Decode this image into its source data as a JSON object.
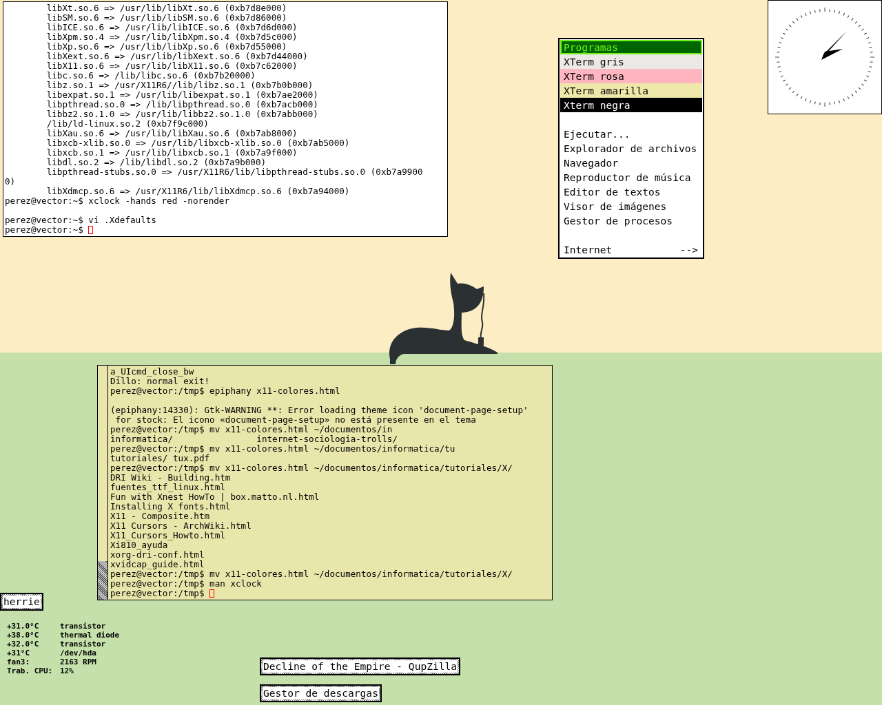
{
  "top_terminal": {
    "lines": [
      {
        "kind": "text",
        "text": "\tlibXt.so.6 => /usr/lib/libXt.so.6 (0xb7d8e000)"
      },
      {
        "kind": "text",
        "text": "\tlibSM.so.6 => /usr/lib/libSM.so.6 (0xb7d86000)"
      },
      {
        "kind": "text",
        "text": "\tlibICE.so.6 => /usr/lib/libICE.so.6 (0xb7d6d000)"
      },
      {
        "kind": "text",
        "text": "\tlibXpm.so.4 => /usr/lib/libXpm.so.4 (0xb7d5c000)"
      },
      {
        "kind": "text",
        "text": "\tlibXp.so.6 => /usr/lib/libXp.so.6 (0xb7d55000)"
      },
      {
        "kind": "text",
        "text": "\tlibXext.so.6 => /usr/lib/libXext.so.6 (0xb7d44000)"
      },
      {
        "kind": "text",
        "text": "\tlibX11.so.6 => /usr/lib/libX11.so.6 (0xb7c62000)"
      },
      {
        "kind": "text",
        "text": "\tlibc.so.6 => /lib/libc.so.6 (0xb7b20000)"
      },
      {
        "kind": "text",
        "text": "\tlibz.so.1 => /usr/X11R6//lib/libz.so.1 (0xb7b0b000)"
      },
      {
        "kind": "text",
        "text": "\tlibexpat.so.1 => /usr/lib/libexpat.so.1 (0xb7ae2000)"
      },
      {
        "kind": "text",
        "text": "\tlibpthread.so.0 => /lib/libpthread.so.0 (0xb7acb000)"
      },
      {
        "kind": "text",
        "text": "\tlibbz2.so.1.0 => /usr/lib/libbz2.so.1.0 (0xb7abb000)"
      },
      {
        "kind": "text",
        "text": "\t/lib/ld-linux.so.2 (0xb7f9c000)"
      },
      {
        "kind": "text",
        "text": "\tlibXau.so.6 => /usr/lib/libXau.so.6 (0xb7ab8000)"
      },
      {
        "kind": "text",
        "text": "\tlibxcb-xlib.so.0 => /usr/lib/libxcb-xlib.so.0 (0xb7ab5000)"
      },
      {
        "kind": "text",
        "text": "\tlibxcb.so.1 => /usr/lib/libxcb.so.1 (0xb7a9f000)"
      },
      {
        "kind": "text",
        "text": "\tlibdl.so.2 => /lib/libdl.so.2 (0xb7a9b000)"
      },
      {
        "kind": "text",
        "text": "\tlibpthread-stubs.so.0 => /usr/X11R6/lib/libpthread-stubs.so.0 (0xb7a9900"
      },
      {
        "kind": "text",
        "text": "0)"
      },
      {
        "kind": "text",
        "text": "\tlibXdmcp.so.6 => /usr/X11R6/lib/libXdmcp.so.6 (0xb7a94000)"
      },
      {
        "kind": "text",
        "text": "perez@vector:~$ xclock -hands red -norender"
      },
      {
        "kind": "blank"
      },
      {
        "kind": "text",
        "text": "perez@vector:~$ vi .Xdefaults"
      }
    ],
    "prompt": "perez@vector:~$ "
  },
  "menu": {
    "items": [
      {
        "kind": "header",
        "label": "Programas",
        "color": "#006400"
      },
      {
        "kind": "item",
        "label": "XTerm gris",
        "color": "#ebe8e6"
      },
      {
        "kind": "item",
        "label": "XTerm rosa",
        "color": "#ffb6c1"
      },
      {
        "kind": "item",
        "label": "XTerm amarilla",
        "color": "#eee8aa"
      },
      {
        "kind": "item",
        "label": "Xterm negra",
        "color": "#000000"
      },
      {
        "kind": "gap"
      },
      {
        "kind": "item",
        "label": "Ejecutar..."
      },
      {
        "kind": "item",
        "label": "Explorador de archivos"
      },
      {
        "kind": "item",
        "label": "Navegador"
      },
      {
        "kind": "item",
        "label": "Reproductor de música"
      },
      {
        "kind": "item",
        "label": "Editor de textos"
      },
      {
        "kind": "item",
        "label": "Visor de imágenes"
      },
      {
        "kind": "item",
        "label": "Gestor de procesos"
      },
      {
        "kind": "gap"
      },
      {
        "kind": "submenu",
        "label": "Internet",
        "arrow": "-->"
      }
    ]
  },
  "bottom_terminal": {
    "lines": [
      {
        "kind": "text",
        "text": "a_UIcmd_close_bw"
      },
      {
        "kind": "text",
        "text": "Dillo: normal exit!"
      },
      {
        "kind": "text",
        "text": "perez@vector:/tmp$ epiphany x11-colores.html"
      },
      {
        "kind": "blank"
      },
      {
        "kind": "text",
        "text": "(epiphany:14330): Gtk-WARNING **: Error loading theme icon 'document-page-setup'"
      },
      {
        "kind": "text",
        "text": " for stock: El icono «document-page-setup» no está presente en el tema"
      },
      {
        "kind": "text",
        "text": "perez@vector:/tmp$ mv x11-colores.html ~/documentos/in"
      },
      {
        "kind": "text",
        "text": "informatica/                internet-sociologia-trolls/"
      },
      {
        "kind": "text",
        "text": "perez@vector:/tmp$ mv x11-colores.html ~/documentos/informatica/tu"
      },
      {
        "kind": "text",
        "text": "tutoriales/ tux.pdf"
      },
      {
        "kind": "text",
        "text": "perez@vector:/tmp$ mv x11-colores.html ~/documentos/informatica/tutoriales/X/"
      },
      {
        "kind": "text",
        "text": "DRI Wiki - Building.htm"
      },
      {
        "kind": "text",
        "text": "fuentes_ttf_linux.html"
      },
      {
        "kind": "text",
        "text": "Fun with Xnest HowTo | box.matto.nl.html"
      },
      {
        "kind": "text",
        "text": "Installing X fonts.html"
      },
      {
        "kind": "text",
        "text": "X11 - Composite.htm"
      },
      {
        "kind": "text",
        "text": "X11 Cursors - ArchWiki.html"
      },
      {
        "kind": "text",
        "text": "X11_Cursors_Howto.html"
      },
      {
        "kind": "text",
        "text": "Xi810_ayuda"
      },
      {
        "kind": "text",
        "text": "xorg-dri-conf.html"
      },
      {
        "kind": "text",
        "text": "xvidcap_guide.html"
      },
      {
        "kind": "text",
        "text": "perez@vector:/tmp$ mv x11-colores.html ~/documentos/informatica/tutoriales/X/"
      },
      {
        "kind": "text",
        "text": "perez@vector:/tmp$ man xclock"
      }
    ],
    "prompt": "perez@vector:/tmp$ "
  },
  "icon_label": "herrie",
  "sensors": [
    {
      "value": "+31.0°C",
      "label": "transistor"
    },
    {
      "value": "+38.0°C",
      "label": "thermal diode"
    },
    {
      "value": "+32.0°C",
      "label": "transistor"
    },
    {
      "value": "+31°C",
      "label": "/dev/hda"
    },
    {
      "value": "fan3:",
      "label": "2163 RPM"
    },
    {
      "value": "Trab. CPU:",
      "label": "12%"
    }
  ],
  "iconified_windows": [
    "Decline of the Empire - QupZilla",
    "Gestor de descargas"
  ]
}
